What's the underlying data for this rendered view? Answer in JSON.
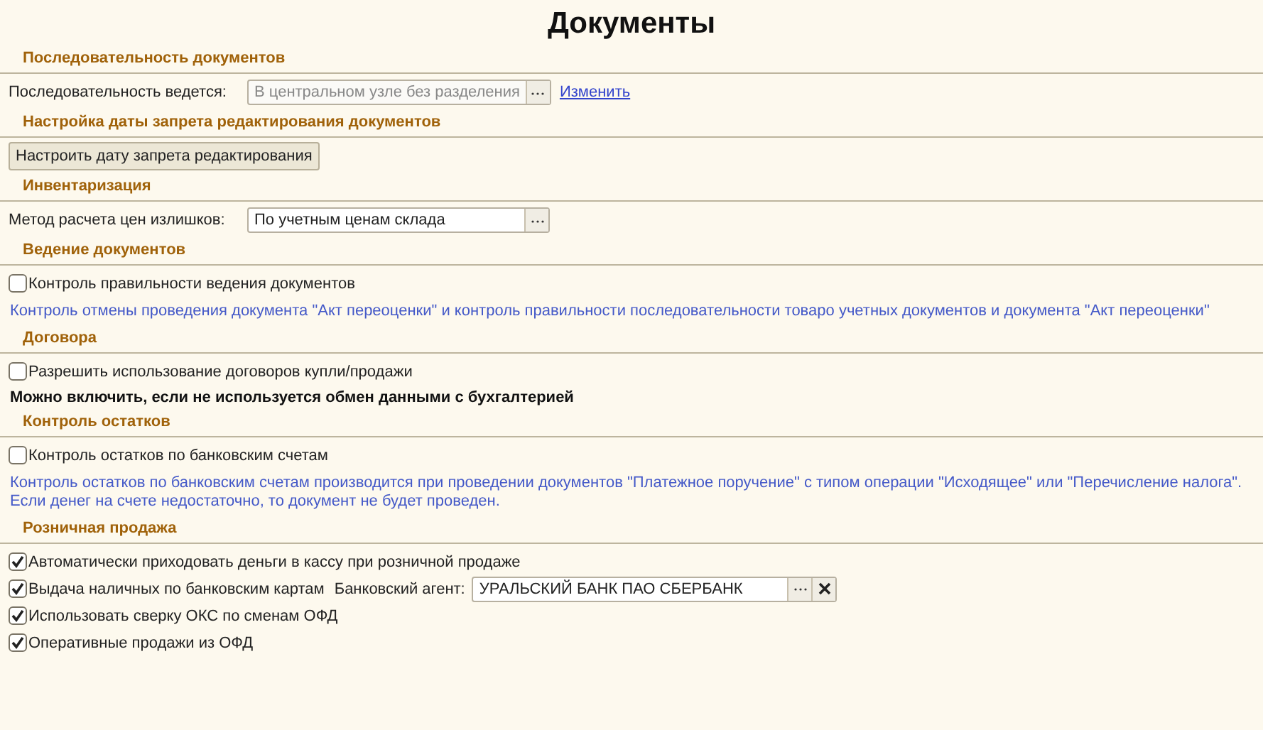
{
  "title": "Документы",
  "sections": [
    {
      "heading": "Последовательность документов",
      "items": [
        {
          "kind": "field",
          "label": "Последовательность ведется:",
          "value": "В центральном узле без разделения",
          "disabled": true,
          "link": "Изменить"
        }
      ]
    },
    {
      "heading": "Настройка даты запрета редактирования документов",
      "items": [
        {
          "kind": "button",
          "label": "Настроить дату запрета редактирования"
        }
      ]
    },
    {
      "heading": "Инвентаризация",
      "items": [
        {
          "kind": "field",
          "label": "Метод расчета цен излишков:",
          "value": "По учетным ценам склада",
          "disabled": false
        }
      ]
    },
    {
      "heading": "Ведение документов",
      "items": [
        {
          "kind": "checkbox",
          "label": "Контроль правильности ведения документов",
          "checked": false
        },
        {
          "kind": "note",
          "lines": [
            "Контроль отмены проведения документа \"Акт переоценки\" и контроль правильности последовательности товаро учетных документов и документа \"Акт переоценки\""
          ]
        }
      ]
    },
    {
      "heading": "Договора",
      "items": [
        {
          "kind": "checkbox",
          "label": "Разрешить использование договоров купли/продажи",
          "checked": false
        },
        {
          "kind": "warning",
          "lines": [
            "Можно включить, если не используется обмен данными с бухгалтерией"
          ]
        }
      ]
    },
    {
      "heading": "Контроль остатков",
      "items": [
        {
          "kind": "checkbox",
          "label": "Контроль остатков по банковским счетам",
          "checked": false
        },
        {
          "kind": "note",
          "lines": [
            "Контроль остатков по банковским счетам производится при проведении документов \"Платежное поручение\" с типом операции \"Исходящее\" или \"Перечисление налога\".",
            "Если денег на счете недостаточно, то документ не будет проведен."
          ]
        }
      ]
    },
    {
      "heading": "Розничная продажа",
      "items": [
        {
          "kind": "checkbox",
          "label": "Автоматически приходовать деньги в кассу при розничной продаже",
          "checked": true
        },
        {
          "kind": "checkbox",
          "label": "Выдача наличных по банковским картам",
          "checked": true,
          "agent_label": "Банковский агент:",
          "agent_value": "УРАЛЬСКИЙ БАНК ПАО СБЕРБАНК"
        },
        {
          "kind": "checkbox",
          "label": "Использовать сверку ОКС по сменам ОФД",
          "checked": true
        },
        {
          "kind": "checkbox",
          "label": "Оперативные продажи из ОФД",
          "checked": true
        }
      ]
    }
  ]
}
